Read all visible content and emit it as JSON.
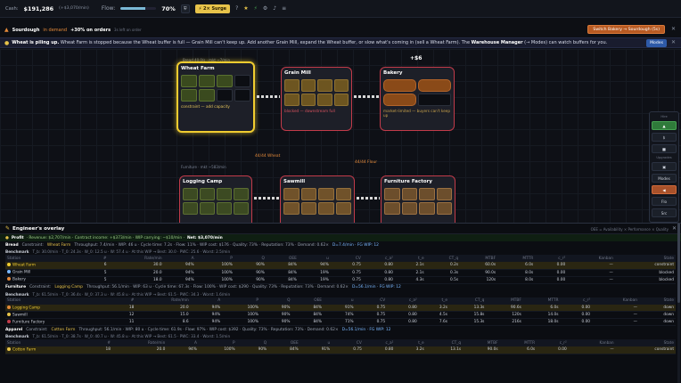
{
  "topbar": {
    "cash_label": "Cash:",
    "cash_value": "$191,286",
    "cash_rate": "(+$3,070/min)",
    "flow_label": "Flow:",
    "flow_pct": "70%",
    "flow_fraction": 0.7,
    "surge_label": "2× Surge",
    "icons": [
      "shield-icon",
      "question-icon",
      "star-icon",
      "bolt-icon",
      "gear-icon",
      "bell-icon",
      "menu-icon"
    ]
  },
  "demand": {
    "product": "Sourdough",
    "text": "in demand",
    "bonus": "+30% on orders",
    "time": "3s left on order",
    "switch_button": "Switch Bakery → Sourdough (5s) ",
    "close": "✕"
  },
  "alert": {
    "strong": "Wheat is piling up.",
    "text": "Wheat Farm is stopped because the Wheat buffer is full — Grain Mill can't keep up. Add another Grain Mill, expand the Wheat buffer, or slow what's coming in (sell a Wheat Farm). The",
    "manager": "Warehouse Manager",
    "manager_tail": "(→ Modes) can watch buffers for you.",
    "modes_button": "Modes",
    "close": "✕"
  },
  "machines": {
    "wheat_farm": {
      "title": "Wheat Farm",
      "status": "constraint — add capacity",
      "label": "Bread 40.0/s · mkt ~7/min"
    },
    "grain_mill": {
      "title": "Grain Mill",
      "status": "blocked — downstream full"
    },
    "bakery": {
      "title": "Bakery",
      "status": "market-limited — buyers can't keep up",
      "plus": "+$6"
    },
    "logging_camp": {
      "title": "Logging Camp",
      "label": "Furniture · mkt ~583/min"
    },
    "sawmill": {
      "title": "Sawmill"
    },
    "furniture_factory": {
      "title": "Furniture Factory"
    },
    "wheat_bubble": "44/44 Wheat",
    "flour_bubble": "44/44 Flour"
  },
  "sidebar": {
    "items": [
      "Hire",
      "$",
      "",
      "Upgrades",
      "",
      "Modes",
      "",
      "Flo",
      "Src"
    ]
  },
  "overlay": {
    "title": "Engineer's overlay",
    "legend": "OEE = Availability × Performance × Quality",
    "close": "✕",
    "profit": {
      "label": "Profit",
      "text": "· Revenue: $2,707/min · Contract income: +$373/min · WIP carrying: −$10/min ·",
      "net": "Net: $3,070/min"
    },
    "sections": [
      {
        "name": "Bread",
        "constraint_label": "Constraint:",
        "constraint": "Wheat Farm",
        "stats": "Throughput: 7.4/min · WIP: 46 u · Cycle time: 7.2s · Flow: 11% · WIP cost: $176 · Quality: 73% · Reputation: 73% · Demand: 0.62×",
        "drum": "D=7.4/min · FG WIP: 12",
        "bench_label": "Benchmark",
        "bench": "T_b: 30.0/min · T_0: 24.3s · W_0: 12.5 u · W: 57.4 u · At this WIP → Best: 30.0 · PWC: 25.6 · Worst: 2.5/min",
        "rows": [
          {
            "station": "Wheat Farm",
            "n": "6",
            "rate": "30.0",
            "A": "94%",
            "P": "100%",
            "Q": "90%",
            "OEE": "84%",
            "u": "94%",
            "CV": "0.75",
            "ca2": "0.80",
            "te": "2.1s",
            "CTq": "0.2s",
            "MTBF": "60.0s",
            "MTTR": "6.0s",
            "cr2": "0.00",
            "kanban": "—",
            "state": "constraint",
            "state_class": "st-constraint",
            "color": "#f0cc30",
            "hl": true
          },
          {
            "station": "Grain Mill",
            "n": "5",
            "rate": "20.0",
            "A": "94%",
            "P": "100%",
            "Q": "90%",
            "OEE": "84%",
            "u": "19%",
            "CV": "0.75",
            "ca2": "0.80",
            "te": "2.1s",
            "CTq": "0.3s",
            "MTBF": "90.0s",
            "MTTR": "8.0s",
            "cr2": "0.00",
            "kanban": "—",
            "state": "blocked",
            "state_class": "st-blocked",
            "color": "#7ab8ff",
            "hl": false
          },
          {
            "station": "Bakery",
            "n": "5",
            "rate": "18.0",
            "A": "94%",
            "P": "100%",
            "Q": "90%",
            "OEE": "84%",
            "u": "19%",
            "CV": "0.75",
            "ca2": "0.80",
            "te": "4.3s",
            "CTq": "0.5s",
            "MTBF": "120s",
            "MTTR": "8.0s",
            "cr2": "0.00",
            "kanban": "—",
            "state": "blocked",
            "state_class": "st-blocked",
            "color": "#e58a3a",
            "hl": false
          }
        ]
      },
      {
        "name": "Furniture",
        "constraint_label": "Constraint:",
        "constraint": "Logging Camp",
        "stats": "Throughput: 56.1/min · WIP: 63 u · Cycle time: 67.3s · Flow: 100% · WIP cost: $290 · Quality: 73% · Reputation: 73% · Demand: 0.62×",
        "drum": "D=56.1/min · FG WIP: 12",
        "bench_label": "Benchmark",
        "bench": "T_b: 61.5/min · T_0: 36.4s · W_0: 37.3 u · W: 45.8 u · At this WIP → Best: 61.5 · PWC: 34.3 · Worst: 1.6/min",
        "rows": [
          {
            "station": "Logging Camp",
            "n": "18",
            "rate": "20.0",
            "A": "94%",
            "P": "100%",
            "Q": "90%",
            "OEE": "84%",
            "u": "91%",
            "CV": "0.75",
            "ca2": "0.80",
            "te": "3.2s",
            "CTq": "13.3s",
            "MTBF": "90.6s",
            "MTTR": "6.0s",
            "cr2": "0.00",
            "kanban": "—",
            "state": "down",
            "state_class": "st-down",
            "color": "#e58a3a",
            "hl": true
          },
          {
            "station": "Sawmill",
            "n": "12",
            "rate": "15.0",
            "A": "94%",
            "P": "100%",
            "Q": "90%",
            "OEE": "84%",
            "u": "74%",
            "CV": "0.75",
            "ca2": "0.80",
            "te": "4.5s",
            "CTq": "15.8s",
            "MTBF": "120s",
            "MTTR": "14.0s",
            "cr2": "0.00",
            "kanban": "—",
            "state": "down",
            "state_class": "st-down",
            "color": "#e7c34a",
            "hl": false
          },
          {
            "station": "Furniture Factory",
            "n": "11",
            "rate": "8.6",
            "A": "94%",
            "P": "100%",
            "Q": "90%",
            "OEE": "84%",
            "u": "71%",
            "CV": "0.75",
            "ca2": "0.80",
            "te": "7.6s",
            "CTq": "15.3s",
            "MTBF": "216s",
            "MTTR": "18.0s",
            "cr2": "0.00",
            "kanban": "—",
            "state": "down",
            "state_class": "st-down",
            "color": "#c23b4a",
            "hl": false
          }
        ]
      },
      {
        "name": "Apparel",
        "constraint_label": "Constraint:",
        "constraint": "Cotton Farm",
        "stats": "Throughput: 56.1/min · WIP: 80 u · Cycle time: 61.9s · Flow: 97% · WIP cost: $392 · Quality: 73% · Reputation: 73% · Demand: 0.62×",
        "drum": "D=56.1/min · FG WIP: 12",
        "bench_label": "Benchmark",
        "bench": "T_b: 61.5/min · T_0: 38.7s · W_0: 40.7 u · W: 45.8 u · At this WIP → Best: 61.5 · PWC: 33.4 · Worst: 1.5/min",
        "rows": [
          {
            "station": "Cotton Farm",
            "n": "18",
            "rate": "20.0",
            "A": "94%",
            "P": "100%",
            "Q": "90%",
            "OEE": "84%",
            "u": "91%",
            "CV": "0.75",
            "ca2": "0.80",
            "te": "3.2s",
            "CTq": "13.1s",
            "MTBF": "90.0s",
            "MTTR": "6.0s",
            "cr2": "0.00",
            "kanban": "—",
            "state": "constraint",
            "state_class": "st-constraint",
            "color": "#e7c34a",
            "hl": true
          }
        ]
      }
    ],
    "headers": [
      "Station",
      "#",
      "Rate/min",
      "A",
      "P",
      "Q",
      "OEE",
      "u",
      "CV",
      "c_a²",
      "t_e",
      "CT_q",
      "MTBF",
      "MTTR",
      "c_r²",
      "Kanban",
      "State"
    ]
  }
}
